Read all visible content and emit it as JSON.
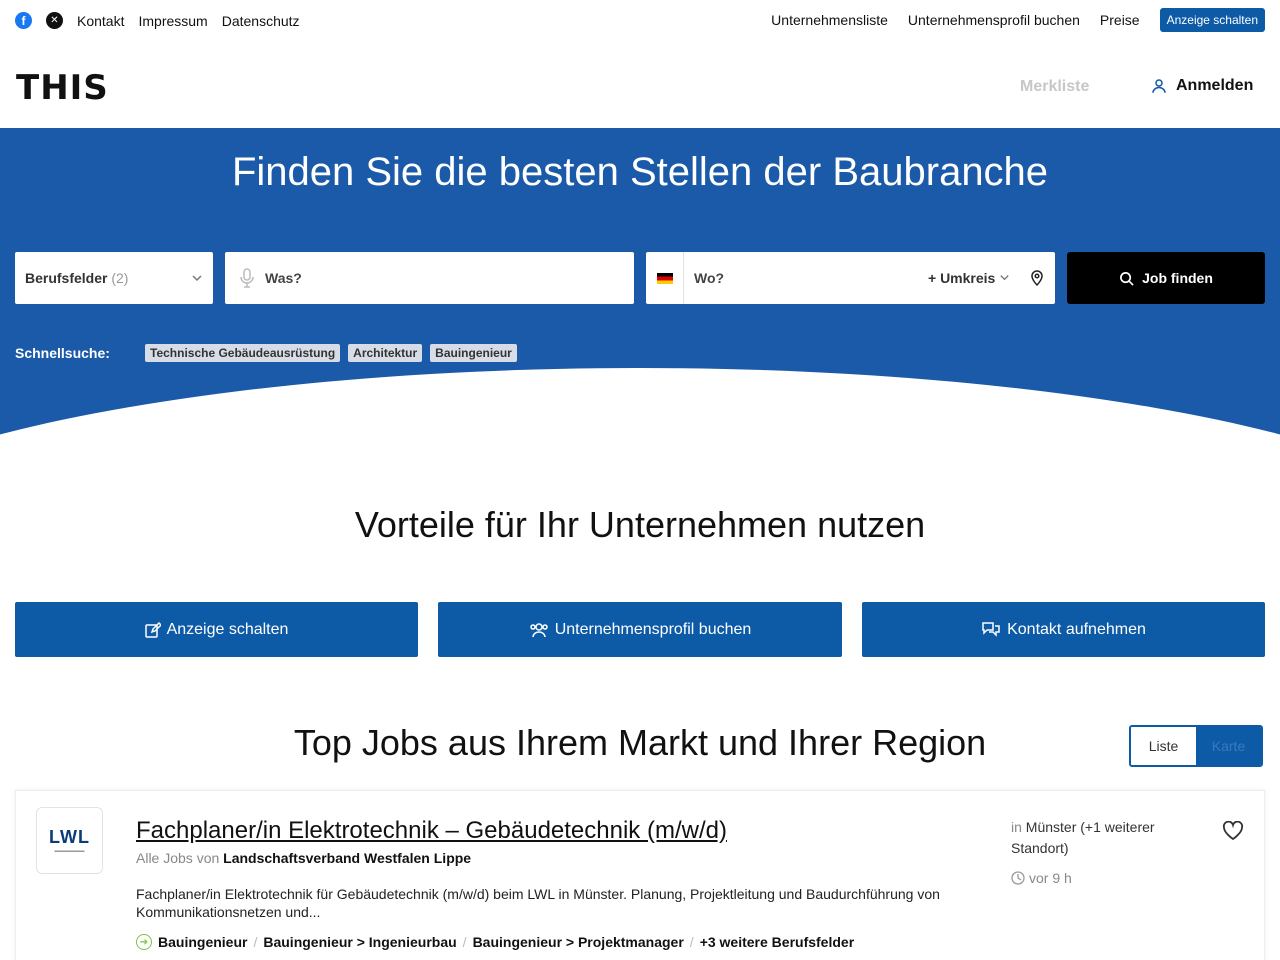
{
  "topbar": {
    "left_links": [
      "Kontakt",
      "Impressum",
      "Datenschutz"
    ],
    "right_links": [
      "Unternehmensliste",
      "Unternehmensprofil buchen",
      "Preise"
    ],
    "cta": "Anzeige schalten"
  },
  "header": {
    "logo": "THIS",
    "merkliste": "Merkliste",
    "anmelden": "Anmelden"
  },
  "hero": {
    "title": "Finden Sie die besten Stellen der Baubranche",
    "berufsfelder_label": "Berufsfelder",
    "berufsfelder_count": "(2)",
    "was_placeholder": "Was?",
    "wo_placeholder": "Wo?",
    "umkreis": "+ Umkreis",
    "search_button": "Job finden",
    "schnellsuche_label": "Schnellsuche:",
    "tags": [
      "Technische Gebäudeausrüstung",
      "Architektur",
      "Bauingenieur"
    ]
  },
  "vorteile": {
    "title": "Vorteile für Ihr Unternehmen nutzen",
    "buttons": [
      "Anzeige schalten",
      "Unternehmensprofil buchen",
      "Kontakt aufnehmen"
    ]
  },
  "jobs": {
    "title": "Top Jobs aus Ihrem Markt und Ihrer Region",
    "toggle": [
      "Liste",
      "Karte"
    ],
    "items": [
      {
        "logo_text": "LWL",
        "title": "Fachplaner/in Elektrotechnik – Gebäudetechnik (m/w/d)",
        "alle_jobs": "Alle Jobs",
        "von": "von",
        "company": "Landschaftsverband Westfalen Lippe",
        "description": "Fachplaner/in Elektrotechnik für Gebäudetechnik (m/w/d) beim LWL in Münster. Planung, Projektleitung und Baudurchführung von Kommunikationsnetzen und...",
        "categories": [
          "Bauingenieur",
          "Bauingenieur > Ingenieurbau",
          "Bauingenieur > Projektmanager",
          "+3 weitere Berufsfelder"
        ],
        "location_prefix": "in",
        "location": "Münster (+1 weiterer Standort)",
        "time": "vor 9 h"
      }
    ]
  },
  "colors": {
    "primary": "#0d5aa7",
    "hero_bg": "#1b5aa8",
    "search_button": "#000000",
    "category_icon": "#7cc242"
  }
}
